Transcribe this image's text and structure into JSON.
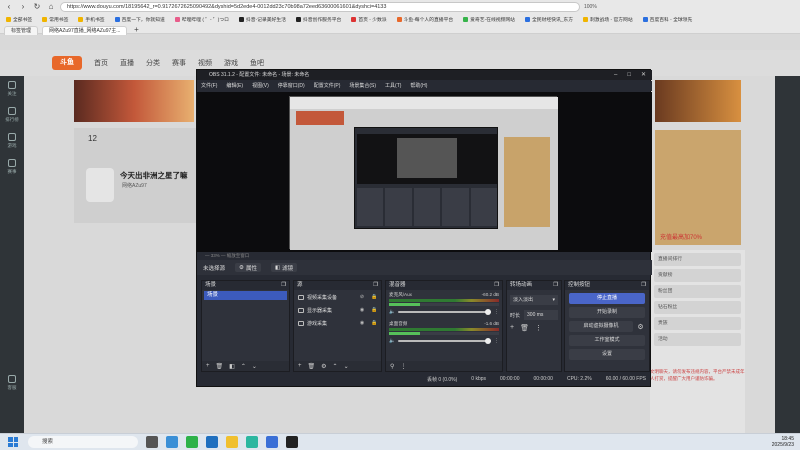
{
  "browser": {
    "url": "https://www.douyu.com/18195642_r=0.9172672625090492&dyshid=5d2ede4-0012dd23c70b98a72eed63600061601&dyshci=4133",
    "zoom": "100%",
    "bookmarks": [
      "全部书签",
      "常用书签",
      "手机书签",
      "百度一下，你就知道",
      "哔哩哔哩 ( ゜- ゜)つロ",
      "抖音-记录美好生活",
      "抖音创作服务平台",
      "首页 - 少数派",
      "斗鱼-每个人的直播平台",
      "爱奇艺-在线视频网站",
      "全民财经快讯_东方",
      "刺激战场 - 官方网站",
      "百度百科 - 全球领先"
    ],
    "tabs": [
      "标签管理",
      "网络AZu97直播_网络AZu97主..."
    ]
  },
  "site": {
    "logo": "斗鱼",
    "nav": [
      "首页",
      "直播",
      "分类",
      "赛事",
      "视频",
      "游戏",
      "鱼吧"
    ],
    "sidebar": [
      "关注",
      "排行榜",
      "游戏",
      "赛事",
      "客服"
    ],
    "room_count": "12",
    "stream_title": "今天出非洲之星了嘛",
    "streamer_name": "网络AZu97",
    "right_panel_text": "充值最高加70%",
    "right_rows": [
      "直播间排行",
      "贡献榜",
      "粉丝团",
      "钻石粉丝",
      "贵族",
      "活动"
    ],
    "right_desc": "文明聊天，请勿发布违规内容，平台严禁未成年人打赏，提醒广大用户谨防诈骗。"
  },
  "obs": {
    "title": "OBS 31.1.2 - 配置文件: 未命名 - 场景: 未命名",
    "menu": [
      "文件(F)",
      "编辑(E)",
      "视图(V)",
      "停靠窗口(D)",
      "配置文件(P)",
      "场景集合(S)",
      "工具(T)",
      "帮助(H)"
    ],
    "preview_status": "— 33%  —  缩放至窗口",
    "source_bar": {
      "label": "未选择源",
      "props": "属性",
      "filters": "滤镜"
    },
    "scenes": {
      "title": "场景",
      "items": [
        "场景"
      ]
    },
    "sources": {
      "title": "源",
      "items": [
        "视频采集设备",
        "显示器采集",
        "游戏采集"
      ]
    },
    "mixer": {
      "title": "混音器",
      "channels": [
        {
          "name": "麦克风/Aux",
          "db": "-60.2 dB"
        },
        {
          "name": "桌面音频",
          "db": "-1.6 dB"
        }
      ]
    },
    "transitions": {
      "title": "转场动画",
      "type": "淡入淡出",
      "duration_label": "时长",
      "duration": "300 ms"
    },
    "controls": {
      "title": "控制按钮",
      "stop_stream": "停止直播",
      "start_record": "开始录制",
      "virtual_cam": "启动虚拟摄像机",
      "studio_mode": "工作室模式",
      "settings": "设置"
    },
    "status": {
      "dropped": "丢帧 0 (0.0%)",
      "bitrate": "0 kbps",
      "rec_time": "00:00:00",
      "stream_time": "00:00:00",
      "cpu": "CPU: 2.2%",
      "fps": "60.00 / 60.00 FPS"
    }
  },
  "taskbar": {
    "search": "搜索",
    "time": "18:45",
    "date": "2025/9/23"
  }
}
